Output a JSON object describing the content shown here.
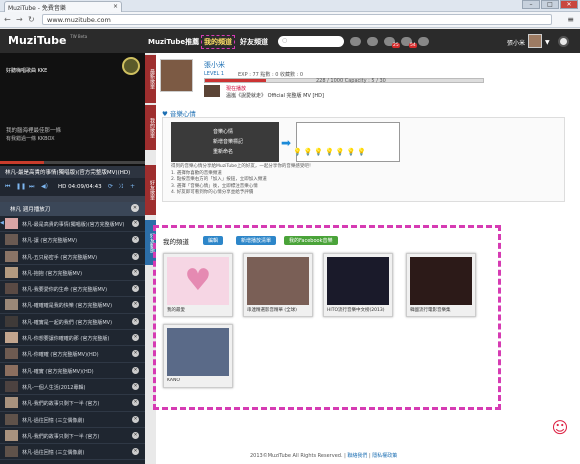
{
  "browser": {
    "tab_title": "MuziTube - 免費音樂",
    "url": "www.muzitube.com",
    "win_min": "–",
    "win_max": "□",
    "win_close": "✕"
  },
  "topnav": {
    "logo": "MuziTube",
    "logo_tag": "TW Beta",
    "links": [
      "MuziTube推薦",
      "我的頻道",
      "好友頻道"
    ],
    "search_placeholder": "",
    "badge1": "25",
    "badge2": "54",
    "user_name": "張小米"
  },
  "player": {
    "title_line": "好聽嗨唱歌曲 KKE",
    "lyric1": "我的腦海裡最佳那一條",
    "lyric2": "有我錯過一條 KKBOX",
    "now_playing": "林凡-最是高貴的事情(獨唱版)(官方完整版MV)(HD)",
    "time": "HD 04:09/04:43",
    "playlist_name": "林凡 週月播放刀"
  },
  "side_tabs": [
    "最新歌單",
    "我的歌單",
    "好友歌單",
    "好友動態"
  ],
  "playlist": [
    "林凡-最是高貴的事情(獨唱版)(官方完整版MV)",
    "林凡-讓 (官方完整版MV)",
    "林凡-五只秘密手 (官方完整版MV)",
    "林凡-抱抱 (官方完整版MV)",
    "林凡-我要愛你的生命 (官方完整版MV)",
    "林凡-確確確是我的快樂 (官方完整版MV)",
    "林凡-確實是一起的我們 (官方完整版MV)",
    "林凡-你想要讓你確確的那 (官方完整版)",
    "林凡-你確確 (官方完整版MV)(HD)",
    "林凡-確實 (官方完整版MV)(HD)",
    "林凡-一個人生活(2012專輯)",
    "林凡-我們的故事只剩下一半 (官方)",
    "林凡-過往回憶 (三立偶像劇)",
    "林凡-我們的故事只剩下一半 (官方)",
    "林凡-過往回憶 (三立偶像劇)"
  ],
  "profile": {
    "name": "張小米",
    "level": "LEVEL 1",
    "stats": "EXP : 77   點數 : 0   收藏數 : 0",
    "exp_text": "228 / 1000   Capacity : 5 / 30",
    "now_title": "現在播放",
    "now_song": "溫嵐《說愛就走》 Official 完整版 MV [HD]"
  },
  "mood": {
    "title": "音樂心情",
    "menu": [
      "音樂心情",
      "新增音樂標記",
      "重新命名"
    ],
    "desc": [
      "得到的音樂心情分享給MuziTube上的好友，一起分享你的音樂感受吧！",
      "1. 選擇你喜歡的音樂頻道",
      "2. 點按音樂右方的「加入」按鈕，立即加入頻道",
      "3. 選擇「音樂心情」後，立即標注音樂心情",
      "4. 好友即可看到你的心情分享並給予評價"
    ]
  },
  "channel": {
    "title": "我的頻道",
    "edit": "編輯",
    "add": "新增播放清單",
    "fb": "我的Facebook音樂",
    "cards": [
      {
        "caption": "我的最愛",
        "color": "#f6d6e4"
      },
      {
        "caption": "串連精選影音精華 (全球)",
        "color": "#7a5f56"
      },
      {
        "caption": "HITO流行音樂中文榜(2013)",
        "color": "#1a1a2a"
      },
      {
        "caption": "韓國流行電影音樂集",
        "color": "#2c1a18"
      },
      {
        "caption": "KANO",
        "color": "#5a6a88"
      }
    ]
  },
  "footer": {
    "copyright": "2013©MuziTube All Rights Reserved. |",
    "link1": "聯絡我們",
    "link2": "隱私權政策"
  }
}
